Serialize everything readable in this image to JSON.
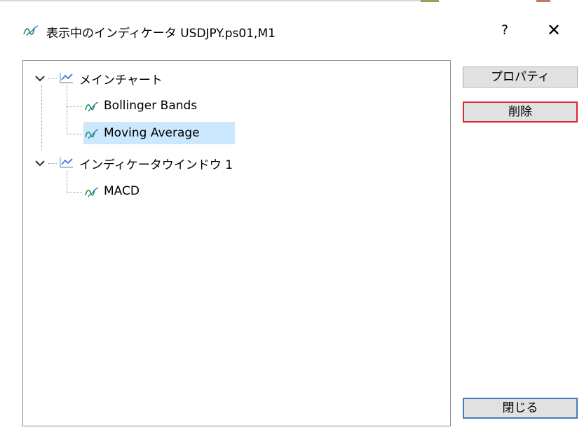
{
  "window": {
    "title": "表示中のインディケータ USDJPY.ps01,M1",
    "help_label": "?",
    "close_label": "✕"
  },
  "tree": {
    "groups": [
      {
        "label": "メインチャート",
        "expanded": true,
        "children": [
          {
            "label": "Bollinger Bands",
            "selected": false
          },
          {
            "label": "Moving Average",
            "selected": true
          }
        ]
      },
      {
        "label": "インディケータウインドウ 1",
        "expanded": true,
        "children": [
          {
            "label": "MACD",
            "selected": false
          }
        ]
      }
    ]
  },
  "buttons": {
    "properties": "プロパティ",
    "delete": "削除",
    "close": "閉じる"
  },
  "colors": {
    "selection": "#cce8ff",
    "focus_outline": "#e0242f",
    "default_outline": "#3f7fbf",
    "indicator_icon": "#1d9a3a"
  }
}
